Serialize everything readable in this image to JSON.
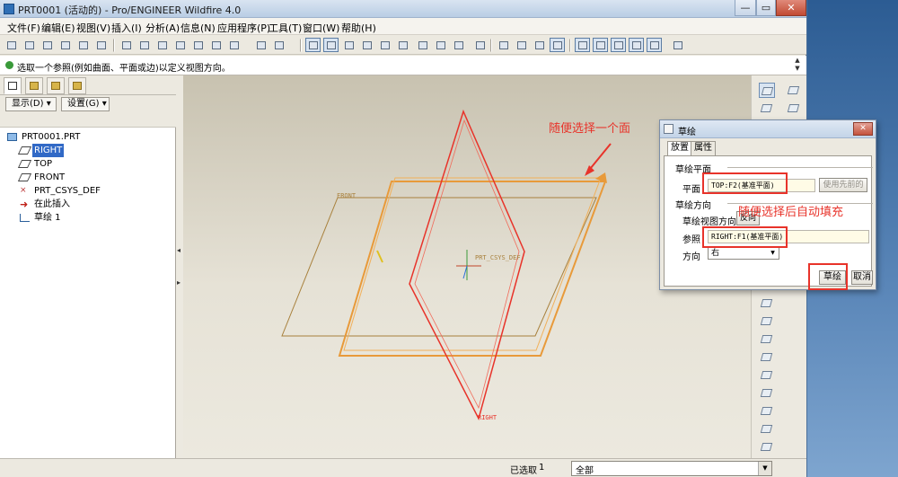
{
  "window": {
    "title": "PRT0001 (活动的) - Pro/ENGINEER Wildfire 4.0"
  },
  "menu": [
    "文件(F)",
    "编辑(E)",
    "视图(V)",
    "插入(I)",
    "分析(A)",
    "信息(N)",
    "应用程序(P)",
    "工具(T)",
    "窗口(W)",
    "帮助(H)"
  ],
  "message": "选取一个参照(例如曲面、平面或边)以定义视图方向。",
  "left_panel": {
    "show_label": "显示(D)",
    "settings_label": "设置(G)",
    "tree": [
      {
        "label": "PRT0001.PRT",
        "icon": "part-icon"
      },
      {
        "label": "RIGHT",
        "icon": "datum-plane-icon"
      },
      {
        "label": "TOP",
        "icon": "datum-plane-icon"
      },
      {
        "label": "FRONT",
        "icon": "datum-plane-icon"
      },
      {
        "label": "PRT_CSYS_DEF",
        "icon": "csys-icon"
      },
      {
        "label": "在此插入",
        "icon": "insert-arrow-icon"
      },
      {
        "label": "草绘 1",
        "icon": "sketch-icon"
      }
    ]
  },
  "graphics": {
    "front_label": "FRONT",
    "csys_label": "PRT_CSYS_DEF",
    "right_label": "RIGHT",
    "annotation_1": "随便选择一个面",
    "annotation_2": "随便选择后自动填充"
  },
  "dialog": {
    "title": "草绘",
    "tabs": [
      "放置",
      "属性"
    ],
    "section_plane": "草绘平面",
    "plane_label": "平面",
    "plane_value": "TOP:F2(基准平面)",
    "use_prev": "使用先前的",
    "section_orient": "草绘方向",
    "view_dir_label": "草绘视图方向",
    "flip_label": "反向",
    "ref_label": "参照",
    "ref_value": "RIGHT:F1(基准平面)",
    "dir_label": "方向",
    "dir_value": "右",
    "ok_label": "草绘",
    "cancel_label": "取消"
  },
  "status": {
    "selected_label": "已选取",
    "selected_count": "1",
    "filter_value": "全部"
  },
  "colors": {
    "highlight_plane": "#e8332a",
    "top_plane": "#e89a3a",
    "front_plane": "#a8803c",
    "annotation": "#e8332a",
    "selection": "#3169c6"
  }
}
